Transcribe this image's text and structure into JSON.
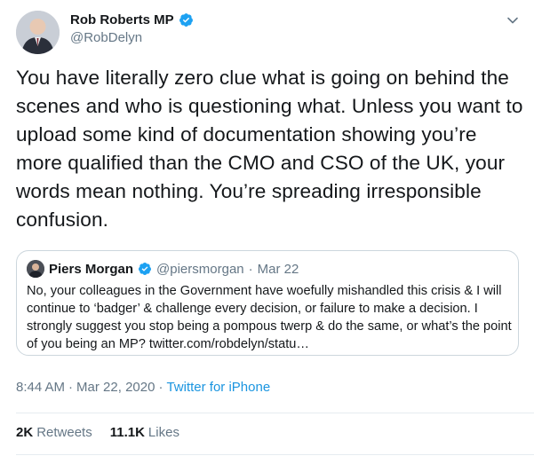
{
  "author": {
    "name": "Rob Roberts MP",
    "handle": "@RobDelyn"
  },
  "tweet_text": "You have literally zero clue what is going on behind the scenes and who is questioning what. Unless you want to upload some kind of documentation showing you’re more qualified than the CMO and CSO of the UK, your words mean nothing. You’re spreading irresponsible confusion.",
  "quoted": {
    "name": "Piers Morgan",
    "handle": "@piersmorgan",
    "separator": "·",
    "date": "Mar 22",
    "text": "No, your colleagues in the Government have woefully mishandled this crisis & I will continue to ‘badger’ & challenge every decision, or failure to make a decision. I strongly suggest you stop being a pompous twerp & do the same, or what’s the point of you being an MP? twitter.com/robdelyn/statu…"
  },
  "meta": {
    "time": "8:44 AM",
    "separator": "·",
    "date": "Mar 22, 2020",
    "separator2": "·",
    "source": "Twitter for iPhone"
  },
  "stats": {
    "retweets_count": "2K",
    "retweets_label": "Retweets",
    "likes_count": "11.1K",
    "likes_label": "Likes"
  },
  "colors": {
    "link": "#1b95e0",
    "verified": "#1da1f2",
    "secondary_text": "#657786",
    "border": "#ccd6dd"
  },
  "icons": [
    "verified-badge-icon",
    "chevron-down-icon"
  ]
}
